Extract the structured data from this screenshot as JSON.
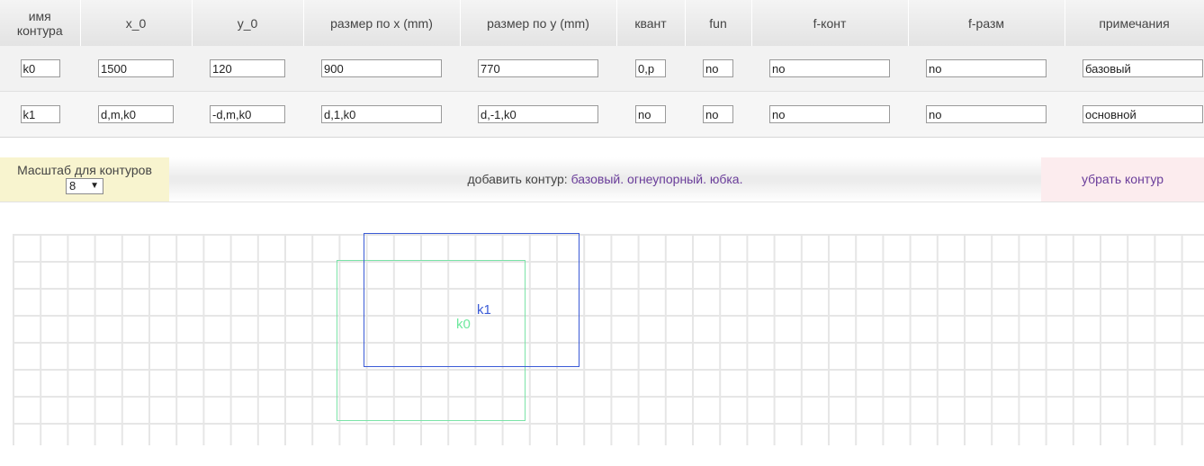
{
  "table": {
    "headers": [
      "имя контура",
      "x_0",
      "y_0",
      "размер по x (mm)",
      "размер по y (mm)",
      "квант",
      "fun",
      "f-конт",
      "f-разм",
      "примечания"
    ],
    "rows": [
      [
        "k0",
        "1500",
        "120",
        "900",
        "770",
        "0,p",
        "no",
        "no",
        "no",
        "базовый"
      ],
      [
        "k1",
        "d,m,k0",
        "-d,m,k0",
        "d,1,k0",
        "d,-1,k0",
        "no",
        "no",
        "no",
        "no",
        "основной"
      ]
    ]
  },
  "toolbar": {
    "scale_label": "Масштаб для контуров",
    "scale_value": "8",
    "scale_arrow": "▼",
    "add_label": "добавить контур:",
    "add_links": [
      "базовый.",
      "огнеупорный.",
      "юбка."
    ],
    "remove_label": "убрать контур"
  },
  "canvas": {
    "contours": [
      {
        "name": "k0",
        "color": "#7ce3a8",
        "label_color": "#6ee89e"
      },
      {
        "name": "k1",
        "color": "#3b5bd6",
        "label_color": "#3b5bd6"
      }
    ],
    "grid_color": "#e6e6e6"
  }
}
